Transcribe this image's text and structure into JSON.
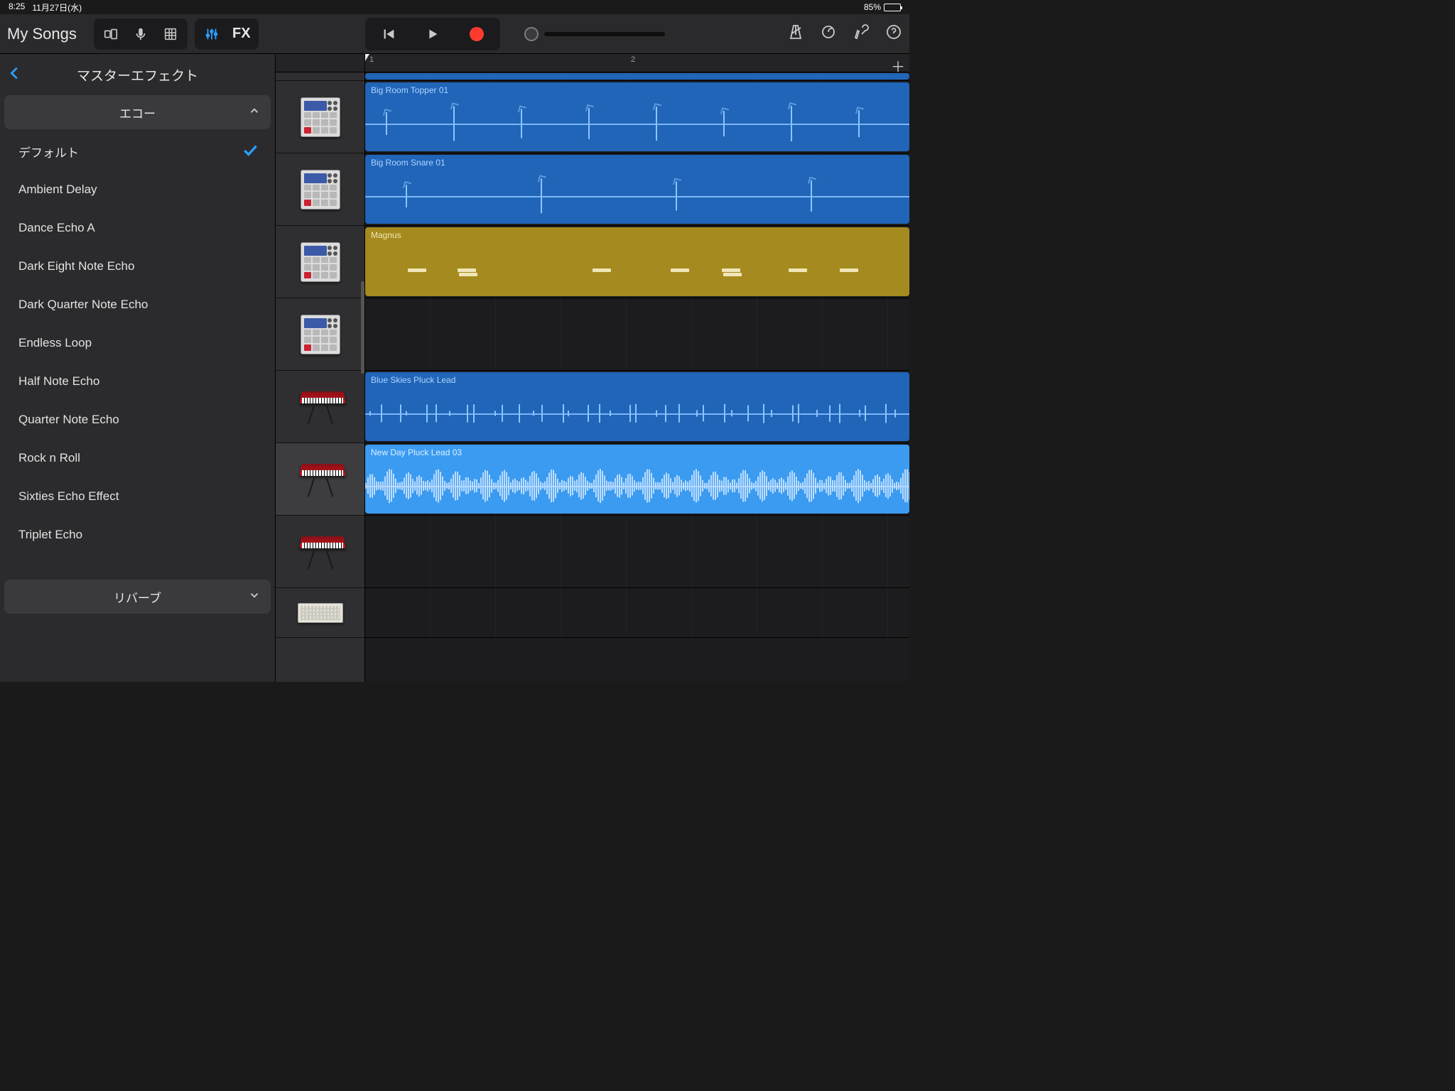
{
  "status": {
    "time": "8:25",
    "date": "11月27日(水)",
    "battery_pct": "85%",
    "battery_fill": 85
  },
  "toolbar": {
    "title": "My Songs",
    "fx_label": "FX"
  },
  "fx": {
    "title": "マスターエフェクト",
    "section_echo": "エコー",
    "section_reverb": "リバーブ",
    "items": [
      {
        "label": "デフォルト",
        "selected": true
      },
      {
        "label": "Ambient Delay"
      },
      {
        "label": "Dance Echo A"
      },
      {
        "label": "Dark Eight Note Echo"
      },
      {
        "label": "Dark Quarter Note Echo"
      },
      {
        "label": "Endless Loop"
      },
      {
        "label": "Half Note Echo"
      },
      {
        "label": "Quarter Note Echo"
      },
      {
        "label": "Rock n Roll"
      },
      {
        "label": "Sixties Echo Effect"
      },
      {
        "label": "Triplet Echo"
      }
    ]
  },
  "ruler": {
    "m1": "1",
    "m2": "2"
  },
  "regions": {
    "r1": "Big Room Topper 01",
    "r2": "Big Room Snare 01",
    "r3": "Magnus",
    "r5": "Blue Skies Pluck Lead",
    "r6": "New Day Pluck Lead 03"
  }
}
